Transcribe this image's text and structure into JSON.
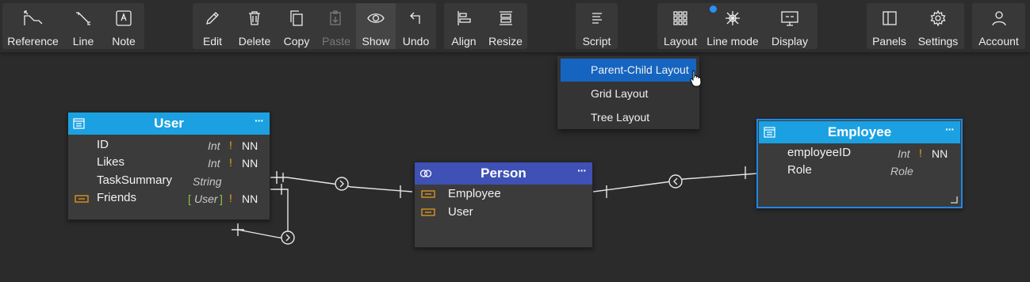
{
  "toolbar": {
    "reference": "Reference",
    "line": "Line",
    "note": "Note",
    "edit": "Edit",
    "delete": "Delete",
    "copy": "Copy",
    "paste": "Paste",
    "show": "Show",
    "undo": "Undo",
    "align": "Align",
    "resize": "Resize",
    "script": "Script",
    "layout": "Layout",
    "line_mode": "Line mode",
    "display": "Display",
    "panels": "Panels",
    "settings": "Settings",
    "account": "Account"
  },
  "layout_menu": {
    "items": [
      "Parent-Child Layout",
      "Grid Layout",
      "Tree Layout"
    ],
    "selected": "Parent-Child Layout"
  },
  "entities": {
    "user": {
      "title": "User",
      "menu": "···",
      "header_color": "#1ba1e2",
      "fields": [
        {
          "name": "ID",
          "type": "Int",
          "required": "!",
          "nn": "NN"
        },
        {
          "name": "Likes",
          "type": "Int",
          "required": "!",
          "nn": "NN"
        },
        {
          "name": "TaskSummary",
          "type": "String"
        },
        {
          "name": "Friends",
          "bracket_open": "[",
          "type": "User",
          "bracket_close": "]",
          "required": "!",
          "nn": "NN"
        }
      ]
    },
    "person": {
      "title": "Person",
      "menu": "···",
      "header_color": "#3f51b5",
      "fields": [
        {
          "name": "Employee"
        },
        {
          "name": "User"
        }
      ]
    },
    "employee": {
      "title": "Employee",
      "menu": "···",
      "header_color": "#1ba1e2",
      "fields": [
        {
          "name": "employeeID",
          "type": "Int",
          "required": "!",
          "nn": "NN"
        },
        {
          "name": "Role",
          "type": "Role"
        }
      ]
    }
  },
  "colors": {
    "accent_blue": "#1565c0",
    "required_orange": "#f2a017",
    "bracket_green": "#8bc34a",
    "notification_dot": "#2f8ef5"
  }
}
